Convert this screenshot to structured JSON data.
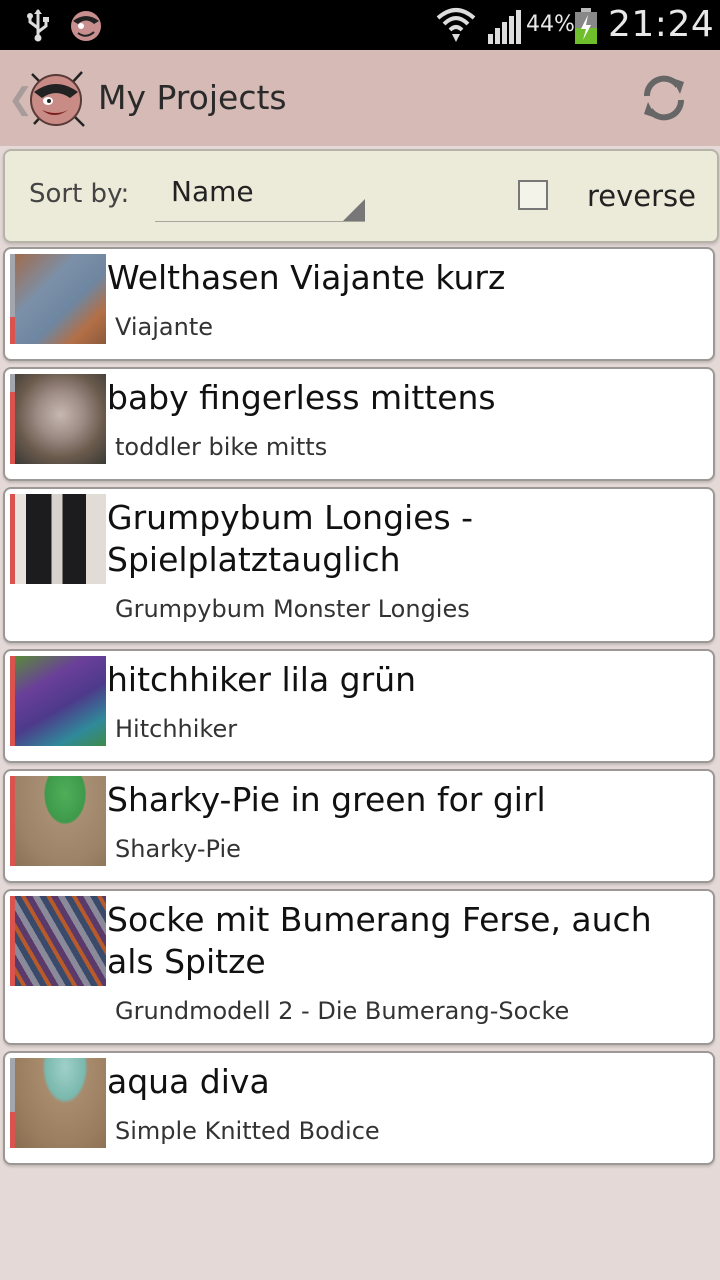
{
  "status_bar": {
    "battery_percent": "44%",
    "clock": "21:24",
    "icons": [
      "usb-icon",
      "app-notification-icon",
      "wifi-icon",
      "signal-icon",
      "battery-charging-icon"
    ]
  },
  "action_bar": {
    "title": "My Projects",
    "icons": [
      "up-caret-icon",
      "app-logo-icon",
      "refresh-icon"
    ]
  },
  "sort": {
    "label": "Sort by:",
    "selected": "Name",
    "reverse_label": "reverse",
    "reverse_checked": false
  },
  "projects": [
    {
      "title": "Welthasen Viajante kurz",
      "pattern": "Viajante",
      "status_color": "#d9534f"
    },
    {
      "title": "baby fingerless mittens",
      "pattern": "toddler bike mitts",
      "status_color": "#d9534f"
    },
    {
      "title": "Grumpybum Longies - Spielplatztauglich",
      "pattern": "Grumpybum Monster Longies",
      "status_color": "#d9534f"
    },
    {
      "title": "hitchhiker lila grün",
      "pattern": "Hitchhiker",
      "status_color": "#d9534f"
    },
    {
      "title": "Sharky-Pie in green for girl",
      "pattern": "Sharky-Pie",
      "status_color": "#d9534f"
    },
    {
      "title": "Socke mit Bumerang Ferse,  auch als Spitze",
      "pattern": "Grundmodell 2 - Die Bumerang-Socke",
      "status_color": "#d9534f"
    },
    {
      "title": "aqua diva",
      "pattern": "Simple Knitted Bodice",
      "status_color": "#d9534f"
    }
  ]
}
